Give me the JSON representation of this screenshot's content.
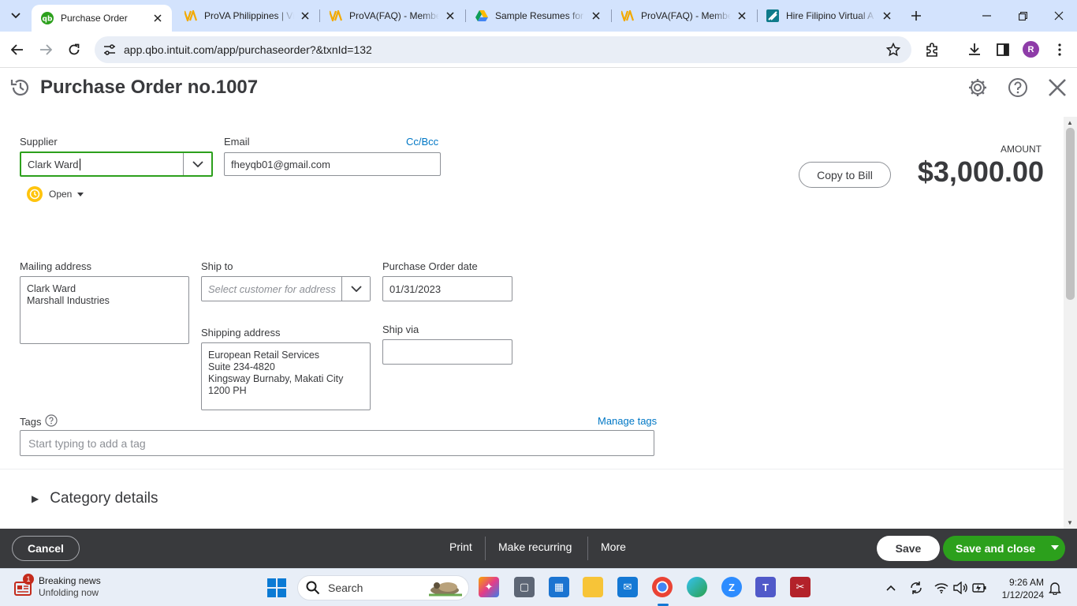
{
  "browser": {
    "tabs": [
      {
        "title": "Purchase Order",
        "favicon": "quickbooks-icon",
        "active": true
      },
      {
        "title": "ProVA Philippines | Vi",
        "favicon": "prova-icon",
        "active": false
      },
      {
        "title": "ProVA(FAQ) - Membe",
        "favicon": "prova-icon",
        "active": false
      },
      {
        "title": "Sample Resumes for",
        "favicon": "google-drive-icon",
        "active": false
      },
      {
        "title": "ProVA(FAQ) - Membe",
        "favicon": "prova-icon",
        "active": false
      },
      {
        "title": "Hire Filipino Virtual A",
        "favicon": "hire-filipino-icon",
        "active": false
      }
    ],
    "url": "app.qbo.intuit.com/app/purchaseorder?&txnId=132",
    "profile_initial": "R"
  },
  "header": {
    "title": "Purchase Order no.1007"
  },
  "form": {
    "supplier_label": "Supplier",
    "supplier_value": "Clark Ward",
    "email_label": "Email",
    "email_value": "fheyqb01@gmail.com",
    "cc_bcc": "Cc/Bcc",
    "status": "Open",
    "amount_label": "AMOUNT",
    "amount_value": "$3,000.00",
    "copy_to_bill": "Copy to Bill",
    "mailing_address_label": "Mailing address",
    "mailing_address": "Clark Ward\nMarshall Industries",
    "ship_to_label": "Ship to",
    "ship_to_placeholder": "Select customer for address",
    "po_date_label": "Purchase Order date",
    "po_date_value": "01/31/2023",
    "shipping_address_label": "Shipping address",
    "shipping_address": "European Retail Services\nSuite 234-4820\nKingsway Burnaby, Makati City\n1200 PH",
    "ship_via_label": "Ship via",
    "ship_via_value": "",
    "tags_label": "Tags",
    "manage_tags": "Manage tags",
    "tags_placeholder": "Start typing to add a tag",
    "category_details": "Category details"
  },
  "footer": {
    "cancel": "Cancel",
    "print": "Print",
    "make_recurring": "Make recurring",
    "more": "More",
    "save": "Save",
    "save_and_close": "Save and close"
  },
  "taskbar": {
    "news_title": "Breaking news",
    "news_subtitle": "Unfolding now",
    "news_badge": "1",
    "search_label": "Search",
    "time": "9:26 AM",
    "date": "1/12/2024"
  },
  "colors": {
    "accent_green": "#2ca01c",
    "link_blue": "#0077c5",
    "footer_bg": "#393a3d",
    "tab_strip": "#d3e3fd"
  }
}
